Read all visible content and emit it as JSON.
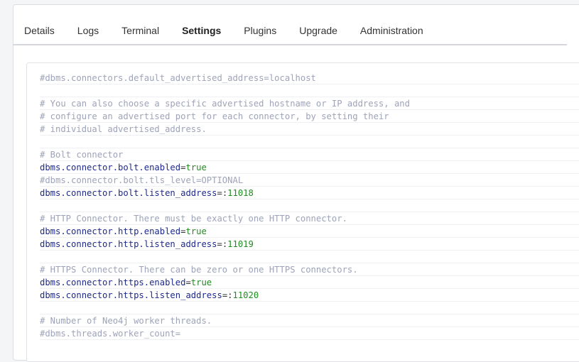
{
  "tabs": [
    {
      "label": "Details"
    },
    {
      "label": "Logs"
    },
    {
      "label": "Terminal"
    },
    {
      "label": "Settings",
      "active": true
    },
    {
      "label": "Plugins"
    },
    {
      "label": "Upgrade"
    },
    {
      "label": "Administration"
    }
  ],
  "config_lines": [
    {
      "type": "comment",
      "text": "#dbms.connectors.default_advertised_address=localhost"
    },
    {
      "type": "blank",
      "text": ""
    },
    {
      "type": "comment",
      "text": "# You can also choose a specific advertised hostname or IP address, and"
    },
    {
      "type": "comment",
      "text": "# configure an advertised port for each connector, by setting their"
    },
    {
      "type": "comment",
      "text": "# individual advertised_address."
    },
    {
      "type": "blank",
      "text": ""
    },
    {
      "type": "comment",
      "text": "# Bolt connector"
    },
    {
      "type": "setting",
      "key": "dbms.connector.bolt.enabled",
      "eq": "=",
      "value": "true"
    },
    {
      "type": "comment",
      "text": "#dbms.connector.bolt.tls_level=OPTIONAL"
    },
    {
      "type": "setting",
      "key": "dbms.connector.bolt.listen_address",
      "eq": "=:",
      "value": "11018"
    },
    {
      "type": "blank",
      "text": ""
    },
    {
      "type": "comment",
      "text": "# HTTP Connector. There must be exactly one HTTP connector."
    },
    {
      "type": "setting",
      "key": "dbms.connector.http.enabled",
      "eq": "=",
      "value": "true"
    },
    {
      "type": "setting",
      "key": "dbms.connector.http.listen_address",
      "eq": "=:",
      "value": "11019"
    },
    {
      "type": "blank",
      "text": ""
    },
    {
      "type": "comment",
      "text": "# HTTPS Connector. There can be zero or one HTTPS connectors."
    },
    {
      "type": "setting",
      "key": "dbms.connector.https.enabled",
      "eq": "=",
      "value": "true"
    },
    {
      "type": "setting",
      "key": "dbms.connector.https.listen_address",
      "eq": "=:",
      "value": "11020"
    },
    {
      "type": "blank",
      "text": ""
    },
    {
      "type": "comment",
      "text": "# Number of Neo4j worker threads."
    },
    {
      "type": "comment",
      "text": "#dbms.threads.worker_count="
    }
  ]
}
